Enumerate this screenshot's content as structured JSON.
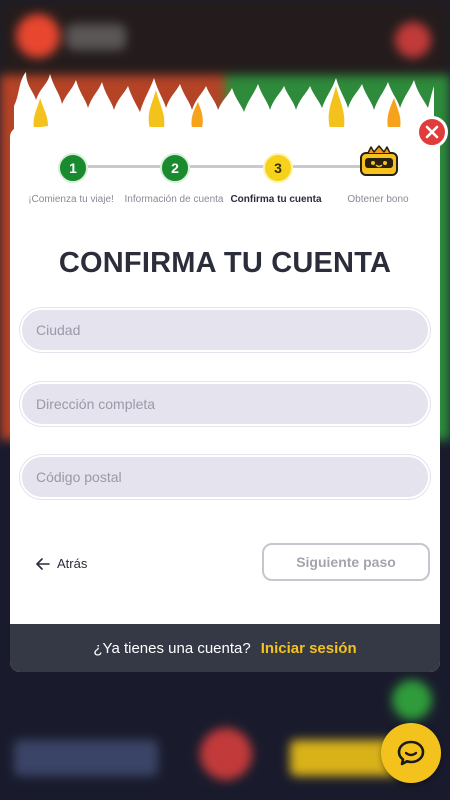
{
  "stepper": {
    "steps": [
      {
        "number": "1",
        "label": "¡Comienza tu viaje!",
        "state": "done"
      },
      {
        "number": "2",
        "label": "Información de cuenta",
        "state": "done"
      },
      {
        "number": "3",
        "label": "Confirma tu cuenta",
        "state": "active"
      },
      {
        "label": "Obtener bono",
        "state": "pending",
        "icon": "treasure-chest-icon"
      }
    ]
  },
  "form": {
    "title": "CONFIRMA TU CUENTA",
    "fields": [
      {
        "placeholder": "Ciudad",
        "value": ""
      },
      {
        "placeholder": "Dirección completa",
        "value": ""
      },
      {
        "placeholder": "Código postal",
        "value": ""
      }
    ],
    "back_label": "Atrás",
    "next_label": "Siguiente paso"
  },
  "footer": {
    "question": "¿Ya tienes una cuenta?",
    "login_label": "Iniciar sesión"
  },
  "colors": {
    "done_step": "#1a8a2e",
    "active_step": "#f6d21a",
    "accent_yellow": "#f4c21d",
    "close_red": "#e23b3b",
    "footer_bg": "#353845"
  },
  "icons": {
    "close": "close-icon",
    "back": "arrow-left-icon",
    "chat": "chat-bubble-icon",
    "bonus": "treasure-chest-icon"
  }
}
